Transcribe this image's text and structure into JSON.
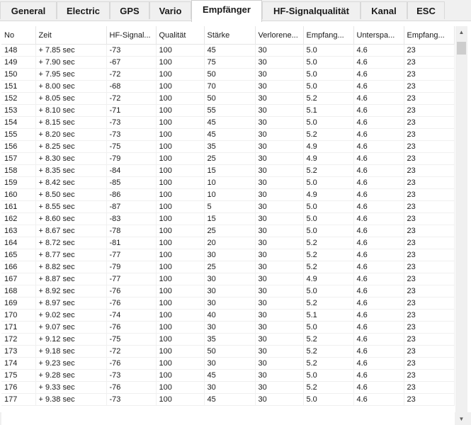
{
  "tabs": [
    {
      "label": "General",
      "active": false
    },
    {
      "label": "Electric",
      "active": false
    },
    {
      "label": "GPS",
      "active": false
    },
    {
      "label": "Vario",
      "active": false
    },
    {
      "label": "Empfänger",
      "active": true
    },
    {
      "label": "HF-Signalqualität",
      "active": false
    },
    {
      "label": "Kanal",
      "active": false
    },
    {
      "label": "ESC",
      "active": false
    }
  ],
  "table": {
    "columns": [
      "No",
      "Zeit",
      "HF-Signal...",
      "Qualität",
      "Stärke",
      "Verlorene...",
      "Empfang...",
      "Unterspa...",
      "Empfang..."
    ],
    "rows": [
      [
        "148",
        "+ 7.85 sec",
        "-73",
        "100",
        "45",
        "30",
        "5.0",
        "4.6",
        "23"
      ],
      [
        "149",
        "+ 7.90 sec",
        "-67",
        "100",
        "75",
        "30",
        "5.0",
        "4.6",
        "23"
      ],
      [
        "150",
        "+ 7.95 sec",
        "-72",
        "100",
        "50",
        "30",
        "5.0",
        "4.6",
        "23"
      ],
      [
        "151",
        "+ 8.00 sec",
        "-68",
        "100",
        "70",
        "30",
        "5.0",
        "4.6",
        "23"
      ],
      [
        "152",
        "+ 8.05 sec",
        "-72",
        "100",
        "50",
        "30",
        "5.2",
        "4.6",
        "23"
      ],
      [
        "153",
        "+ 8.10 sec",
        "-71",
        "100",
        "55",
        "30",
        "5.1",
        "4.6",
        "23"
      ],
      [
        "154",
        "+ 8.15 sec",
        "-73",
        "100",
        "45",
        "30",
        "5.0",
        "4.6",
        "23"
      ],
      [
        "155",
        "+ 8.20 sec",
        "-73",
        "100",
        "45",
        "30",
        "5.2",
        "4.6",
        "23"
      ],
      [
        "156",
        "+ 8.25 sec",
        "-75",
        "100",
        "35",
        "30",
        "4.9",
        "4.6",
        "23"
      ],
      [
        "157",
        "+ 8.30 sec",
        "-79",
        "100",
        "25",
        "30",
        "4.9",
        "4.6",
        "23"
      ],
      [
        "158",
        "+ 8.35 sec",
        "-84",
        "100",
        "15",
        "30",
        "5.2",
        "4.6",
        "23"
      ],
      [
        "159",
        "+ 8.42 sec",
        "-85",
        "100",
        "10",
        "30",
        "5.0",
        "4.6",
        "23"
      ],
      [
        "160",
        "+ 8.50 sec",
        "-86",
        "100",
        "10",
        "30",
        "4.9",
        "4.6",
        "23"
      ],
      [
        "161",
        "+ 8.55 sec",
        "-87",
        "100",
        "5",
        "30",
        "5.0",
        "4.6",
        "23"
      ],
      [
        "162",
        "+ 8.60 sec",
        "-83",
        "100",
        "15",
        "30",
        "5.0",
        "4.6",
        "23"
      ],
      [
        "163",
        "+ 8.67 sec",
        "-78",
        "100",
        "25",
        "30",
        "5.0",
        "4.6",
        "23"
      ],
      [
        "164",
        "+ 8.72 sec",
        "-81",
        "100",
        "20",
        "30",
        "5.2",
        "4.6",
        "23"
      ],
      [
        "165",
        "+ 8.77 sec",
        "-77",
        "100",
        "30",
        "30",
        "5.2",
        "4.6",
        "23"
      ],
      [
        "166",
        "+ 8.82 sec",
        "-79",
        "100",
        "25",
        "30",
        "5.2",
        "4.6",
        "23"
      ],
      [
        "167",
        "+ 8.87 sec",
        "-77",
        "100",
        "30",
        "30",
        "4.9",
        "4.6",
        "23"
      ],
      [
        "168",
        "+ 8.92 sec",
        "-76",
        "100",
        "30",
        "30",
        "5.0",
        "4.6",
        "23"
      ],
      [
        "169",
        "+ 8.97 sec",
        "-76",
        "100",
        "30",
        "30",
        "5.2",
        "4.6",
        "23"
      ],
      [
        "170",
        "+ 9.02 sec",
        "-74",
        "100",
        "40",
        "30",
        "5.1",
        "4.6",
        "23"
      ],
      [
        "171",
        "+ 9.07 sec",
        "-76",
        "100",
        "30",
        "30",
        "5.0",
        "4.6",
        "23"
      ],
      [
        "172",
        "+ 9.12 sec",
        "-75",
        "100",
        "35",
        "30",
        "5.2",
        "4.6",
        "23"
      ],
      [
        "173",
        "+ 9.18 sec",
        "-72",
        "100",
        "50",
        "30",
        "5.2",
        "4.6",
        "23"
      ],
      [
        "174",
        "+ 9.23 sec",
        "-76",
        "100",
        "30",
        "30",
        "5.2",
        "4.6",
        "23"
      ],
      [
        "175",
        "+ 9.28 sec",
        "-73",
        "100",
        "45",
        "30",
        "5.0",
        "4.6",
        "23"
      ],
      [
        "176",
        "+ 9.33 sec",
        "-76",
        "100",
        "30",
        "30",
        "5.2",
        "4.6",
        "23"
      ],
      [
        "177",
        "+ 9.38 sec",
        "-73",
        "100",
        "45",
        "30",
        "5.0",
        "4.6",
        "23"
      ]
    ]
  },
  "icons": {
    "scroll_up": "▲",
    "scroll_down": "▼"
  }
}
